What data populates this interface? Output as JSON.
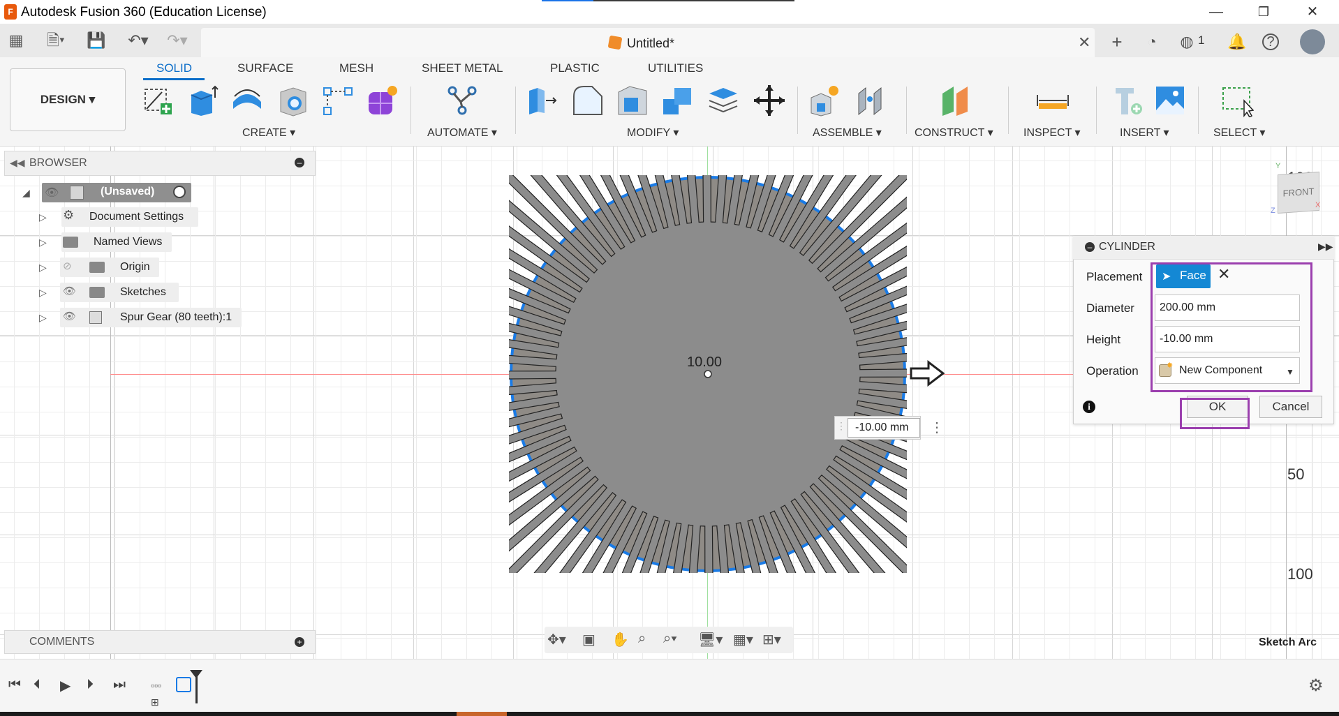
{
  "window": {
    "title": "Autodesk Fusion 360 (Education License)",
    "logo_letter": "F",
    "minimize": "—",
    "restore": "❐",
    "close": "✕"
  },
  "tabbar": {
    "document_title": "Untitled*",
    "close_glyph": "✕",
    "new_tab_glyph": "+",
    "notification_count": "1"
  },
  "toolbar": {
    "workspace": "DESIGN ▾",
    "tabs": [
      "SOLID",
      "SURFACE",
      "MESH",
      "SHEET METAL",
      "PLASTIC",
      "UTILITIES"
    ],
    "groups": [
      "CREATE ▾",
      "AUTOMATE ▾",
      "MODIFY ▾",
      "ASSEMBLE ▾",
      "CONSTRUCT ▾",
      "INSPECT ▾",
      "INSERT ▾",
      "SELECT ▾"
    ]
  },
  "browser": {
    "title": "BROWSER",
    "root": "(Unsaved)",
    "items": [
      {
        "label": "Document Settings",
        "icon": "gear-icon"
      },
      {
        "label": "Named Views",
        "icon": "folder-icon"
      },
      {
        "label": "Origin",
        "icon": "folder-icon"
      },
      {
        "label": "Sketches",
        "icon": "folder-icon"
      },
      {
        "label": "Spur Gear (80 teeth):1",
        "icon": "component-icon"
      }
    ]
  },
  "comments": {
    "title": "COMMENTS"
  },
  "canvas": {
    "center_dimension": "10.00",
    "dimension_input": "-10.00 mm",
    "ruler_labels": [
      "100",
      "50",
      "100"
    ],
    "viewcube_face": "FRONT",
    "axis_x": "X",
    "axis_y": "Y",
    "axis_z": "Z",
    "status_text": "Sketch Arc",
    "colors": {
      "selection_edge": "#1a7be6",
      "disc_fill": "#8f8b86",
      "highlight": "#9b3fae"
    }
  },
  "dialog": {
    "title": "CYLINDER",
    "placement_label": "Placement",
    "placement_value": "Face",
    "diameter_label": "Diameter",
    "diameter_value": "200.00 mm",
    "height_label": "Height",
    "height_value": "-10.00 mm",
    "operation_label": "Operation",
    "operation_value": "New Component",
    "ok_label": "OK",
    "cancel_label": "Cancel"
  }
}
